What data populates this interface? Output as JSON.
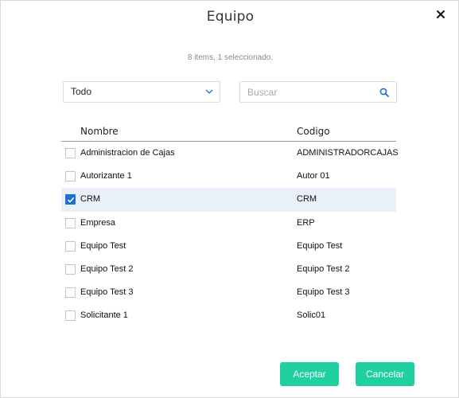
{
  "dialog": {
    "title": "Equipo",
    "summary": "8 items, 1 seleccionado."
  },
  "filter": {
    "selected_option": "Todo"
  },
  "search": {
    "placeholder": "Buscar",
    "value": ""
  },
  "table": {
    "headers": {
      "name": "Nombre",
      "code": "Codigo"
    },
    "rows": [
      {
        "name": "Administracion de Cajas",
        "code": "ADMINISTRADORCAJAS",
        "checked": false
      },
      {
        "name": "Autorizante 1",
        "code": "Autor 01",
        "checked": false
      },
      {
        "name": "CRM",
        "code": "CRM",
        "checked": true
      },
      {
        "name": "Empresa",
        "code": "ERP",
        "checked": false
      },
      {
        "name": "Equipo Test",
        "code": "Equipo Test",
        "checked": false
      },
      {
        "name": "Equipo Test 2",
        "code": "Equipo Test 2",
        "checked": false
      },
      {
        "name": "Equipo Test 3",
        "code": "Equipo Test 3",
        "checked": false
      },
      {
        "name": "Solicitante 1",
        "code": "Solic01",
        "checked": false
      }
    ]
  },
  "buttons": {
    "accept_label": "Aceptar",
    "cancel_label": "Cancelar"
  },
  "colors": {
    "accent": "#1fd1a0",
    "checkbox_checked": "#1f6fd0",
    "selected_row": "#e9f0f9",
    "search_icon": "#1f6fd0"
  },
  "icons": {
    "close": "close-icon",
    "dropdown": "chevron-down-icon",
    "search": "search-icon",
    "check": "checkmark-icon"
  }
}
